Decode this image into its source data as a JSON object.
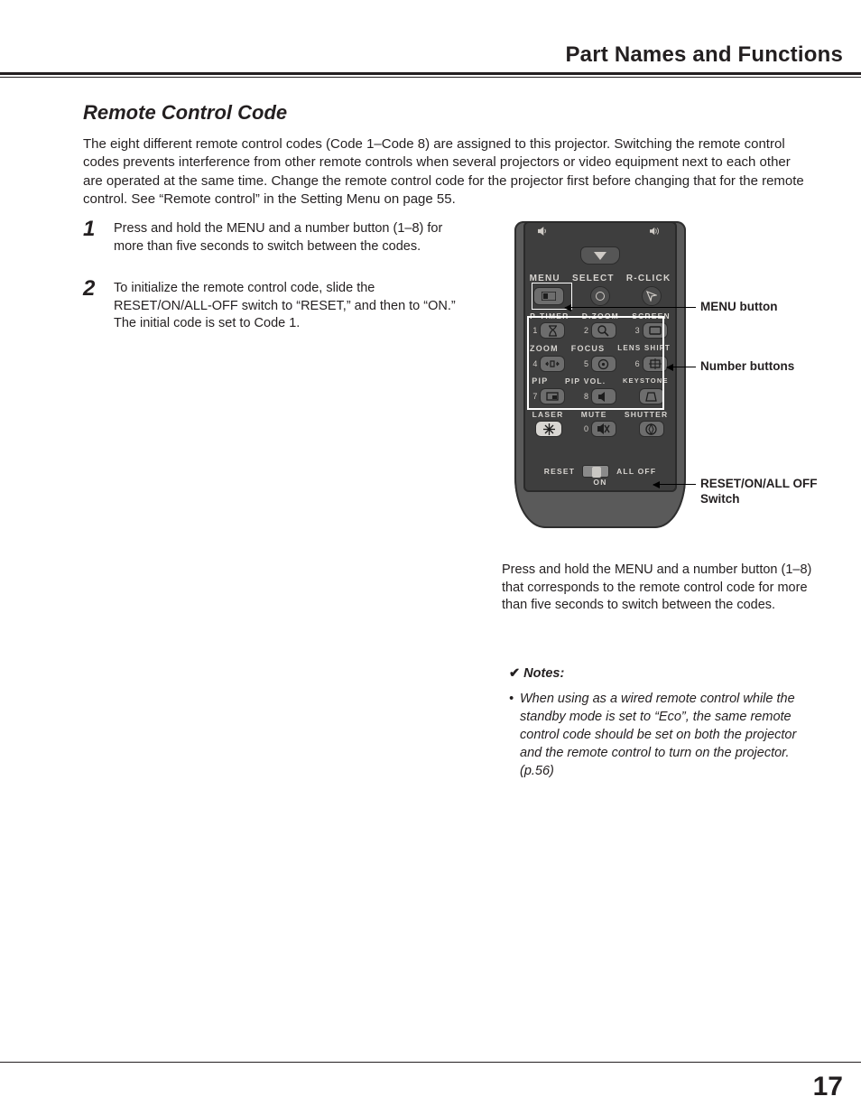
{
  "header": {
    "section": "Part Names and Functions"
  },
  "section_title": "Remote Control Code",
  "intro": "The eight different remote control codes (Code 1–Code 8) are assigned to this projector. Switching the remote control codes prevents interference from other remote controls when several projectors or video equipment next to each other are operated at the same time. Change the remote control code for the projector first before changing that for the remote control. See “Remote control” in the Setting Menu on page 55.",
  "steps": [
    {
      "num": "1",
      "text": "Press and hold the MENU and a number button (1–8) for more than five seconds to switch between the codes."
    },
    {
      "num": "2",
      "text": "To initialize the remote control code, slide the RESET/ON/ALL-OFF switch to “RESET,” and then to “ON.” The initial code is set to Code 1."
    }
  ],
  "remote": {
    "top_labels": [
      "MENU",
      "SELECT",
      "R-CLICK"
    ],
    "sect_labels_1": [
      "P-TIMER",
      "D.ZOOM",
      "SCREEN"
    ],
    "sect_labels_2": [
      "ZOOM",
      "FOCUS",
      "LENS SHIFT"
    ],
    "sect_labels_3": [
      "PIP",
      "PIP VOL.",
      "KEYSTONE"
    ],
    "sect_labels_4": [
      "LASER",
      "MUTE",
      "SHUTTER"
    ],
    "numbers": [
      "1",
      "2",
      "3",
      "4",
      "5",
      "6",
      "7",
      "8",
      "0"
    ],
    "switch": {
      "left": "RESET",
      "right": "ALL OFF",
      "bottom": "ON"
    }
  },
  "callouts": {
    "menu": "MENU button",
    "numbers": "Number buttons",
    "reset": "RESET/ON/ALL OFF Switch"
  },
  "caption": "Press and hold the MENU and a number button (1–8) that corresponds to the remote control code for more than five seconds to switch between the codes.",
  "notes": {
    "heading": "Notes:",
    "items": [
      "When using as a wired remote control while the standby mode is set to “Eco”, the same remote control code should be set on both the projector and the remote control to turn on the projector. (p.56)"
    ]
  },
  "page_number": "17"
}
